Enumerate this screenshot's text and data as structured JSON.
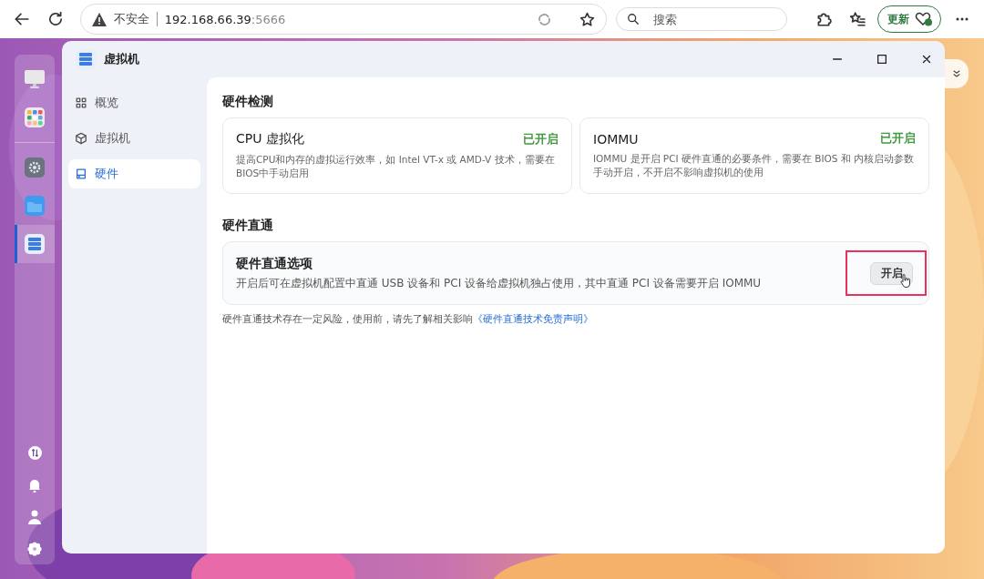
{
  "browser": {
    "security": "不安全",
    "url_host": "192.168.66.39",
    "url_port": ":5666",
    "search_placeholder": "搜索",
    "update_button": "更新"
  },
  "dock": {
    "top": [
      {
        "kind": "monitor",
        "selected": false
      },
      {
        "kind": "apps",
        "selected": false
      }
    ],
    "middle": [
      {
        "kind": "gear",
        "selected": false
      },
      {
        "kind": "folder",
        "selected": false
      },
      {
        "kind": "vm",
        "selected": true
      }
    ],
    "bottom": [
      {
        "kind": "transfer"
      },
      {
        "kind": "bell"
      },
      {
        "kind": "user"
      },
      {
        "kind": "settings"
      }
    ]
  },
  "window": {
    "title": "虚拟机"
  },
  "sidebar": {
    "items": [
      {
        "label": "概览",
        "kind": "grid",
        "selected": false
      },
      {
        "label": "虚拟机",
        "kind": "cube",
        "selected": false
      },
      {
        "label": "硬件",
        "kind": "drive",
        "selected": true
      }
    ]
  },
  "detection": {
    "heading": "硬件检测",
    "cards": [
      {
        "title": "CPU 虚拟化",
        "status": "已开启",
        "enabled": true,
        "description": "提高CPU和内存的虚拟运行效率，如 Intel VT-x 或 AMD-V 技术，需要在BIOS中手动启用"
      },
      {
        "title": "IOMMU",
        "status": "已开启",
        "enabled": true,
        "description": "IOMMU 是开启 PCI 硬件直通的必要条件，需要在 BIOS 和 内核启动参数手动开启，不开启不影响虚拟机的使用"
      }
    ]
  },
  "passthrough": {
    "heading": "硬件直通",
    "option": {
      "title": "硬件直通选项",
      "description": "开启后可在虚拟机配置中直通 USB 设备和 PCI 设备给虚拟机独占使用，其中直通 PCI 设备需要开启 IOMMU",
      "button": "开启",
      "highlighted": true
    },
    "note": "硬件直通技术存在一定风险，使用前，请先了解相关影响",
    "note_link": "《硬件直通技术免责声明》"
  }
}
